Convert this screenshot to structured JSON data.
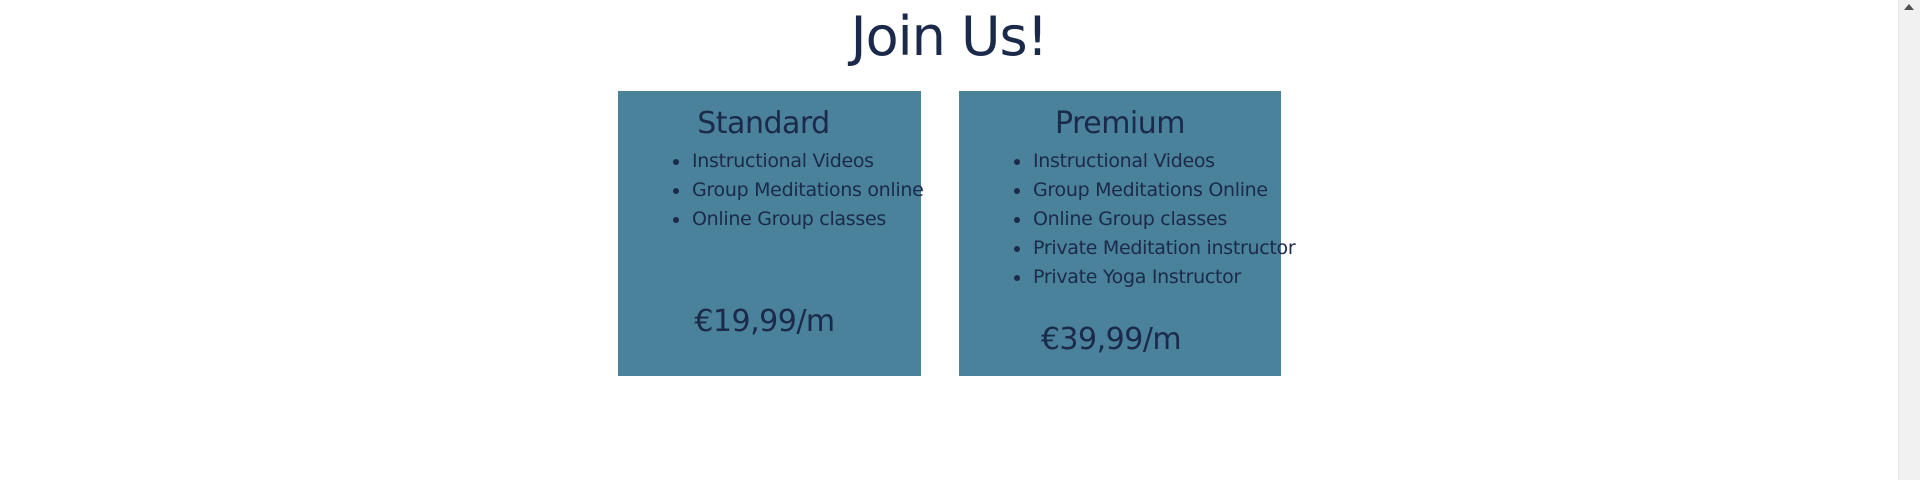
{
  "page": {
    "title": "Join Us!"
  },
  "plans": {
    "standard": {
      "title": "Standard",
      "features": [
        "Instructional Videos",
        "Group Meditations online",
        "Online Group classes"
      ],
      "price": "€19,99/m"
    },
    "premium": {
      "title": "Premium",
      "features": [
        "Instructional Videos",
        "Group Meditations Online",
        "Online Group classes",
        "Private Meditation instructor",
        "Private Yoga Instructor"
      ],
      "price": "€39,99/m"
    }
  },
  "colors": {
    "text": "#1b2a4a",
    "card_background": "#4a819b",
    "page_background": "#ffffff",
    "scrollbar_track": "#f1f1f1"
  },
  "icons": {
    "bullet": "bullet-dot-icon",
    "scroll_up": "scroll-up-arrow-icon"
  }
}
